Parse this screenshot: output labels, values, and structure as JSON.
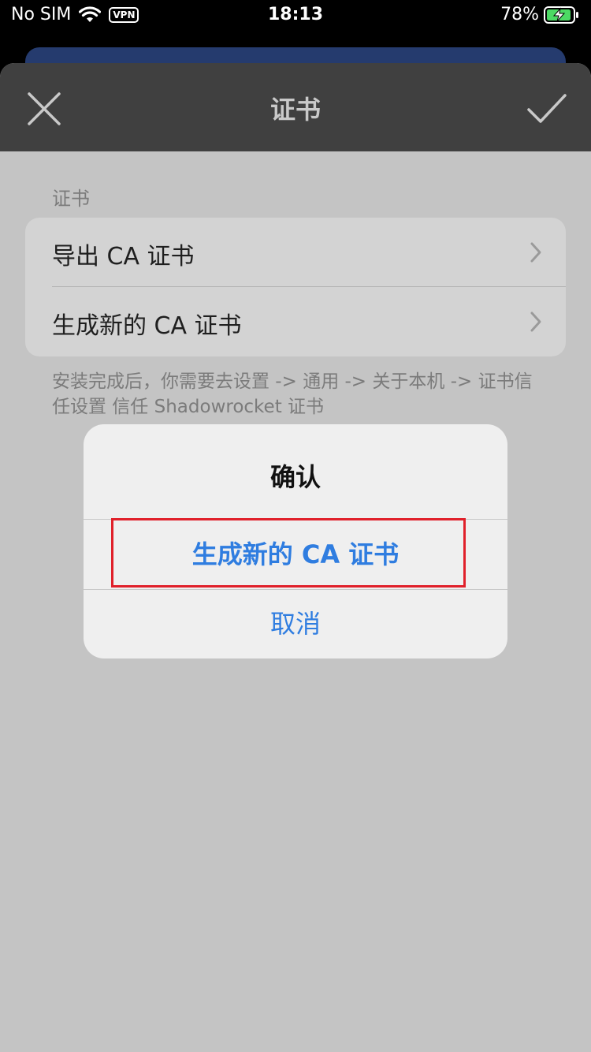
{
  "status_bar": {
    "carrier": "No SIM",
    "vpn": "VPN",
    "time": "18:13",
    "battery": "78%",
    "icons": [
      "wifi-icon",
      "vpn-badge",
      "battery-charging-icon"
    ]
  },
  "nav": {
    "title": "证书",
    "close_icon": "close-icon",
    "done_icon": "checkmark-icon"
  },
  "section": {
    "header": "证书",
    "rows": [
      {
        "label": "导出 CA 证书",
        "icon": "chevron-right-icon"
      },
      {
        "label": "生成新的 CA 证书",
        "icon": "chevron-right-icon"
      }
    ],
    "footer": "安装完成后，你需要去设置 -> 通用 -> 关于本机 -> 证书信任设置 信任 Shadowrocket 证书"
  },
  "alert": {
    "title": "确认",
    "primary_label": "生成新的 CA 证书",
    "cancel_label": "取消"
  },
  "colors": {
    "accent": "#2f7de0",
    "highlight": "#e0202a",
    "nav_bg": "#404040"
  }
}
